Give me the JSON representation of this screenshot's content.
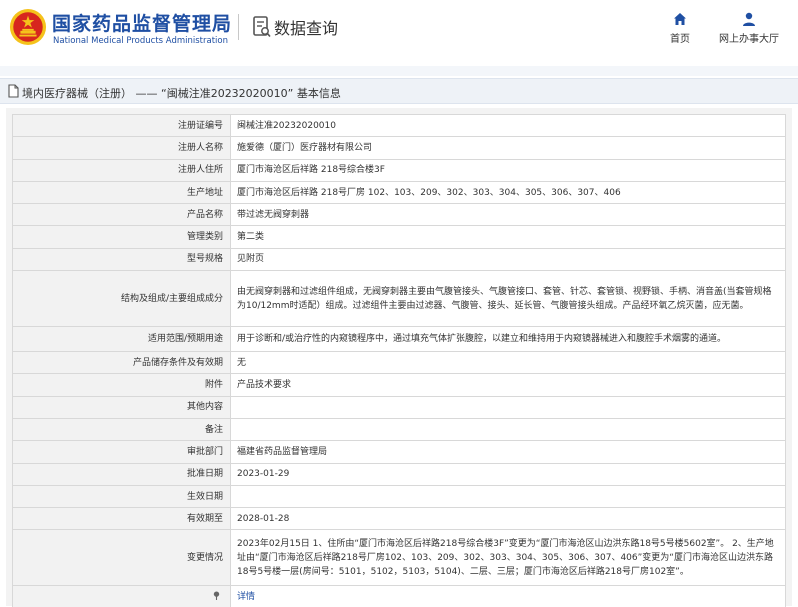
{
  "header": {
    "brand_cn": "国家药品监督管理局",
    "brand_en": "National Medical Products Administration",
    "query_title": "数据查询",
    "nav": {
      "home": "首页",
      "online_hall": "网上办事大厅"
    }
  },
  "breadcrumb": {
    "text": "境内医疗器械（注册） —— “闽械注准20232020010” 基本信息"
  },
  "colors": {
    "brand_blue": "#1f4fa3",
    "emblem_red": "#d7261e",
    "emblem_gold": "#f5c21b"
  },
  "icons": [
    "national-emblem-icon",
    "data-query-icon",
    "home-icon",
    "user-icon",
    "document-icon",
    "pin-icon"
  ],
  "details": [
    {
      "label": "注册证编号",
      "value": "闽械注准20232020010"
    },
    {
      "label": "注册人名称",
      "value": "施爱德（厦门）医疗器材有限公司"
    },
    {
      "label": "注册人住所",
      "value": "厦门市海沧区后祥路 218号综合楼3F"
    },
    {
      "label": "生产地址",
      "value": "厦门市海沧区后祥路 218号厂房 102、103、209、302、303、304、305、306、307、406"
    },
    {
      "label": "产品名称",
      "value": "带过滤无阀穿刺器"
    },
    {
      "label": "管理类别",
      "value": "第二类"
    },
    {
      "label": "型号规格",
      "value": "见附页"
    },
    {
      "label": "结构及组成/主要组成成分",
      "value": "由无阀穿刺器和过滤组件组成，无阀穿刺器主要由气腹管接头、气腹管接口、套管、针芯、套管锁、视野锁、手柄、消音盖(当套管规格为10/12mm时适配）组成。过滤组件主要由过滤器、气腹管、接头、延长管、气腹管接头组成。产品经环氧乙烷灭菌，应无菌。"
    },
    {
      "label": "适用范围/预期用途",
      "value": "用于诊断和/或治疗性的内窥镜程序中，通过填充气体扩张腹腔，以建立和维持用于内窥镜器械进入和腹腔手术烟雾的通道。"
    },
    {
      "label": "产品储存条件及有效期",
      "value": "无"
    },
    {
      "label": "附件",
      "value": "产品技术要求"
    },
    {
      "label": "其他内容",
      "value": ""
    },
    {
      "label": "备注",
      "value": ""
    },
    {
      "label": "审批部门",
      "value": "福建省药品监督管理局"
    },
    {
      "label": "批准日期",
      "value": "2023-01-29"
    },
    {
      "label": "生效日期",
      "value": ""
    },
    {
      "label": "有效期至",
      "value": "2028-01-28"
    },
    {
      "label": "变更情况",
      "value": "2023年02月15日 1、住所由“厦门市海沧区后祥路218号综合楼3F”变更为“厦门市海沧区山边洪东路18号5号楼5602室”。 2、生产地址由“厦门市海沧区后祥路218号厂房102、103、209、302、303、304、305、306、307、406”变更为“厦门市海沧区山边洪东路18号5号楼一层(房间号：5101，5102，5103，5104)、二层、三层；厦门市海沧区后祥路218号厂房102室”。"
    }
  ],
  "detail_link": {
    "label": "",
    "value": "详情"
  }
}
